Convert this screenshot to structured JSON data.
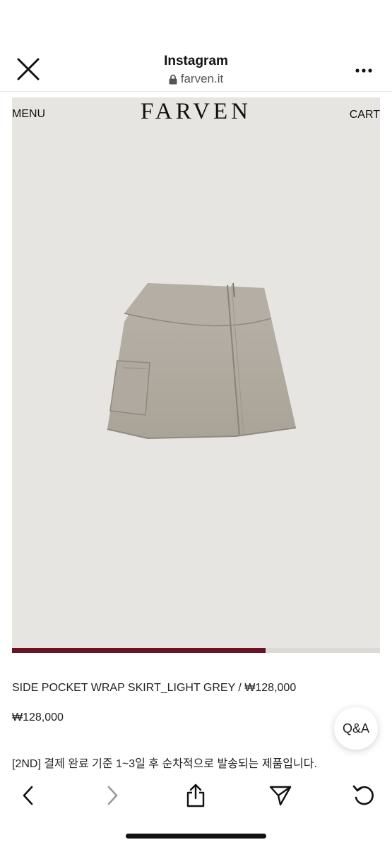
{
  "browser": {
    "title": "Instagram",
    "url": "farven.it",
    "close_icon": "close-icon",
    "more_icon": "more-dots-icon",
    "lock_icon": "lock-icon"
  },
  "site": {
    "menu_label": "MENU",
    "brand": "FARVEN",
    "cart_label": "CART"
  },
  "gallery": {
    "progress": 0.69,
    "accent": "#6a1325",
    "background": "#e7e5e1"
  },
  "product": {
    "name": "SIDE POCKET WRAP SKIRT_LIGHT GREY / ₩128,000",
    "price": "₩128,000",
    "notice": "[2ND] 결제 완료 기준 1~3일 후 순차적으로 발송되는 제품입니다."
  },
  "qa_button": {
    "label": "Q&A"
  },
  "toolbar": {
    "back_icon": "chevron-left-icon",
    "forward_icon": "chevron-right-icon",
    "share_icon": "share-icon",
    "send_icon": "send-icon",
    "reload_icon": "reload-icon"
  }
}
